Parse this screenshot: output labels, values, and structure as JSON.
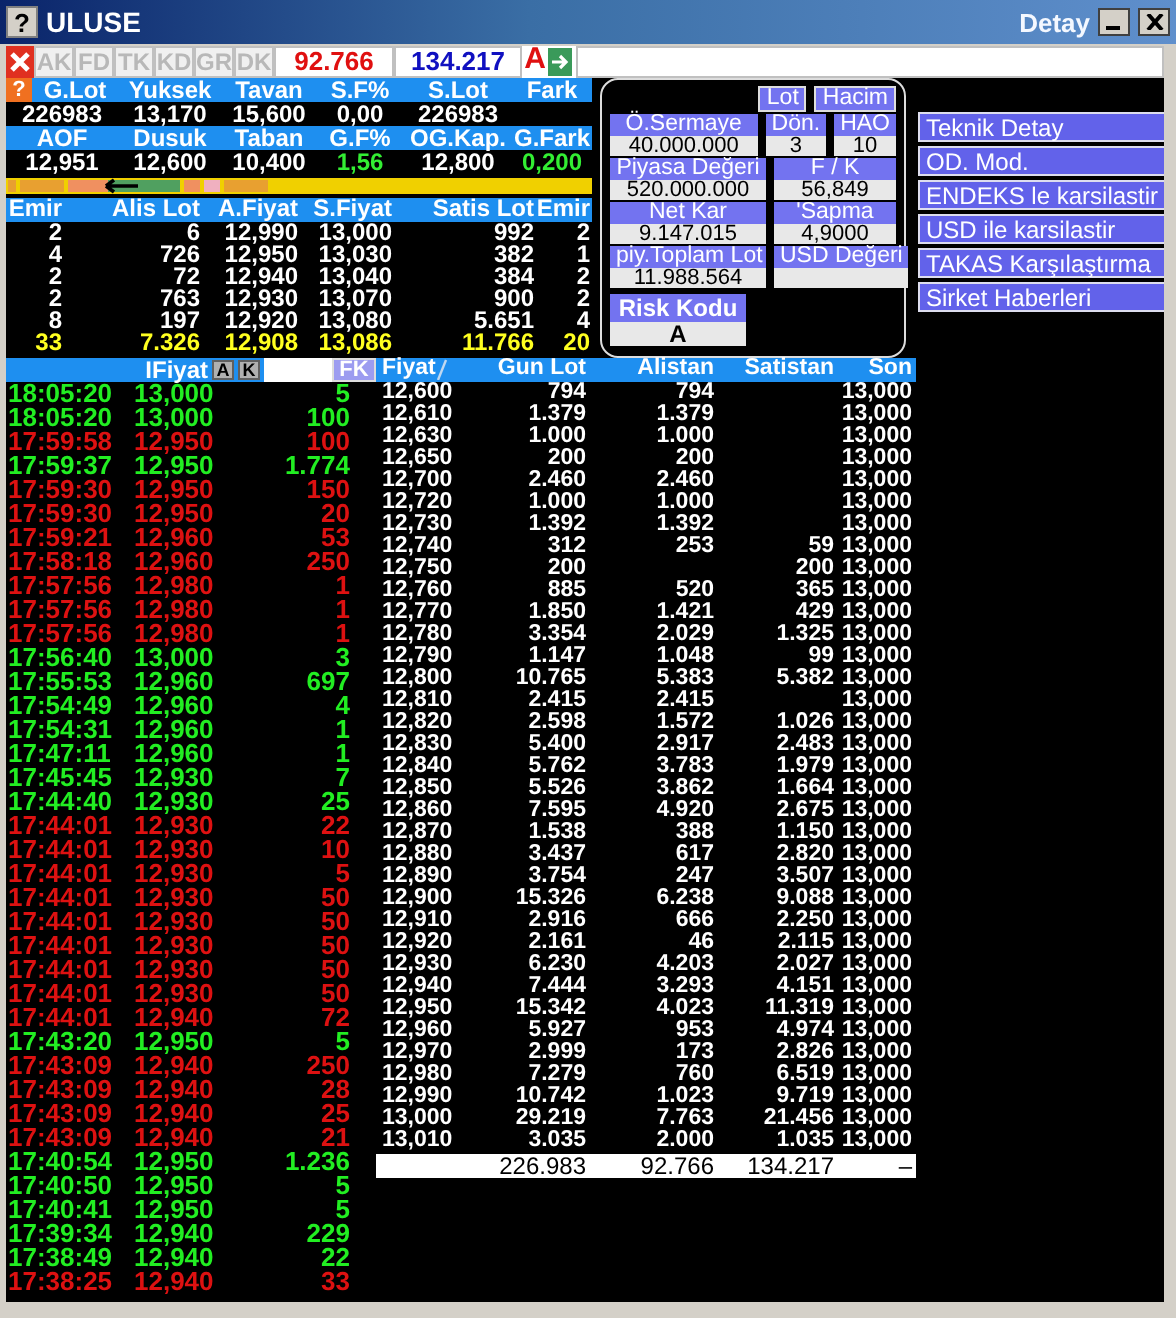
{
  "window": {
    "help": "?",
    "title": "ULUSE",
    "subtitle": "Detay"
  },
  "toolbar": {
    "tabs": [
      {
        "label": "AK",
        "disabled": true
      },
      {
        "label": "FD",
        "disabled": true
      },
      {
        "label": "TK",
        "disabled": true
      },
      {
        "label": "KD",
        "disabled": true
      },
      {
        "label": "GR",
        "disabled": true
      },
      {
        "label": "DK",
        "disabled": true
      }
    ],
    "buy_total": "92.766",
    "sell_total": "134.217",
    "alert": "A"
  },
  "quote": {
    "help": "?",
    "rows": [
      {
        "labels": [
          "G.Lot",
          "Yuksek",
          "Tavan",
          "S.F%",
          "S.Lot",
          "Fark"
        ],
        "values": [
          {
            "text": "226983",
            "kind": "plain"
          },
          {
            "text": "13,170",
            "kind": "plain"
          },
          {
            "text": "15,600",
            "kind": "plain"
          },
          {
            "text": "0,00",
            "kind": "plain"
          },
          {
            "text": "226983",
            "kind": "plain"
          }
        ]
      },
      {
        "labels": [
          "AOF",
          "Dusuk",
          "Taban",
          "G.F%",
          "OG.Kap.",
          "G.Fark"
        ],
        "values": [
          {
            "text": "12,951",
            "kind": "plain"
          },
          {
            "text": "12,600",
            "kind": "plain"
          },
          {
            "text": "10,400",
            "kind": "plain"
          },
          {
            "text": "1,56",
            "kind": "gain"
          },
          {
            "text": "12,800",
            "kind": "plain"
          },
          {
            "text": "0,200",
            "kind": "gain"
          }
        ]
      }
    ]
  },
  "depth": {
    "columns": [
      "Emir",
      "Alis Lot",
      "A.Fiyat",
      "S.Fiyat",
      "Satis Lot",
      "Emir"
    ],
    "rows": [
      [
        "2",
        "6",
        "12,990",
        "13,000",
        "992",
        "2"
      ],
      [
        "4",
        "726",
        "12,950",
        "13,030",
        "382",
        "1"
      ],
      [
        "2",
        "72",
        "12,940",
        "13,040",
        "384",
        "2"
      ],
      [
        "2",
        "763",
        "12,930",
        "13,070",
        "900",
        "2"
      ],
      [
        "8",
        "197",
        "12,920",
        "13,080",
        "5.651",
        "4"
      ]
    ],
    "totals": [
      "33",
      "7.326",
      "12,908",
      "13,086",
      "11.766",
      "20"
    ]
  },
  "panel": {
    "toggles": [
      "Lot",
      "Hacim"
    ],
    "stat_rows": [
      [
        {
          "label": "Ö.Sermaye",
          "value": "40.000.000"
        },
        {
          "label": "Dön.",
          "value": "3"
        },
        {
          "label": "HAO",
          "value": "10"
        }
      ],
      [
        {
          "label": "Piyasa Değeri",
          "value": "520.000.000"
        },
        {
          "label": "F / K",
          "value": "56,849"
        }
      ],
      [
        {
          "label": "Net Kar",
          "value": "9.147.015"
        },
        {
          "label": "'Sapma",
          "value": "4,9000"
        }
      ],
      [
        {
          "label": "piy.Toplam Lot",
          "value": "11.988.564"
        },
        {
          "label": "USD Değeri"
        }
      ]
    ],
    "risk": {
      "label": "Risk Kodu",
      "value": "A"
    }
  },
  "actions": [
    "Teknik Detay",
    "OD. Mod.",
    "ENDEKS le karsilastir",
    "USD ile karsilastir",
    "TAKAS Karşılaştırma",
    "Sirket Haberleri"
  ],
  "trades": {
    "header": "IFiyat",
    "buttons": [
      "A",
      "K"
    ],
    "filter": "FK",
    "rows": [
      {
        "time": "18:05:20",
        "price": "13,000",
        "lot": "5",
        "kind": "up"
      },
      {
        "time": "18:05:20",
        "price": "13,000",
        "lot": "100",
        "kind": "up"
      },
      {
        "time": "17:59:58",
        "price": "12,950",
        "lot": "100",
        "kind": "down"
      },
      {
        "time": "17:59:37",
        "price": "12,950",
        "lot": "1.774",
        "kind": "up"
      },
      {
        "time": "17:59:30",
        "price": "12,950",
        "lot": "150",
        "kind": "down"
      },
      {
        "time": "17:59:30",
        "price": "12,950",
        "lot": "20",
        "kind": "down"
      },
      {
        "time": "17:59:21",
        "price": "12,960",
        "lot": "53",
        "kind": "down"
      },
      {
        "time": "17:58:18",
        "price": "12,960",
        "lot": "250",
        "kind": "down"
      },
      {
        "time": "17:57:56",
        "price": "12,980",
        "lot": "1",
        "kind": "down"
      },
      {
        "time": "17:57:56",
        "price": "12,980",
        "lot": "1",
        "kind": "down"
      },
      {
        "time": "17:57:56",
        "price": "12,980",
        "lot": "1",
        "kind": "down"
      },
      {
        "time": "17:56:40",
        "price": "13,000",
        "lot": "3",
        "kind": "up"
      },
      {
        "time": "17:55:53",
        "price": "12,960",
        "lot": "697",
        "kind": "up"
      },
      {
        "time": "17:54:49",
        "price": "12,960",
        "lot": "4",
        "kind": "up"
      },
      {
        "time": "17:54:31",
        "price": "12,960",
        "lot": "1",
        "kind": "up"
      },
      {
        "time": "17:47:11",
        "price": "12,960",
        "lot": "1",
        "kind": "up"
      },
      {
        "time": "17:45:45",
        "price": "12,930",
        "lot": "7",
        "kind": "up"
      },
      {
        "time": "17:44:40",
        "price": "12,930",
        "lot": "25",
        "kind": "up"
      },
      {
        "time": "17:44:01",
        "price": "12,930",
        "lot": "22",
        "kind": "down"
      },
      {
        "time": "17:44:01",
        "price": "12,930",
        "lot": "10",
        "kind": "down"
      },
      {
        "time": "17:44:01",
        "price": "12,930",
        "lot": "5",
        "kind": "down"
      },
      {
        "time": "17:44:01",
        "price": "12,930",
        "lot": "50",
        "kind": "down"
      },
      {
        "time": "17:44:01",
        "price": "12,930",
        "lot": "50",
        "kind": "down"
      },
      {
        "time": "17:44:01",
        "price": "12,930",
        "lot": "50",
        "kind": "down"
      },
      {
        "time": "17:44:01",
        "price": "12,930",
        "lot": "50",
        "kind": "down"
      },
      {
        "time": "17:44:01",
        "price": "12,930",
        "lot": "50",
        "kind": "down"
      },
      {
        "time": "17:44:01",
        "price": "12,940",
        "lot": "72",
        "kind": "down"
      },
      {
        "time": "17:43:20",
        "price": "12,950",
        "lot": "5",
        "kind": "up"
      },
      {
        "time": "17:43:09",
        "price": "12,940",
        "lot": "250",
        "kind": "down"
      },
      {
        "time": "17:43:09",
        "price": "12,940",
        "lot": "28",
        "kind": "down"
      },
      {
        "time": "17:43:09",
        "price": "12,940",
        "lot": "25",
        "kind": "down"
      },
      {
        "time": "17:43:09",
        "price": "12,940",
        "lot": "21",
        "kind": "down"
      },
      {
        "time": "17:40:54",
        "price": "12,950",
        "lot": "1.236",
        "kind": "up"
      },
      {
        "time": "17:40:50",
        "price": "12,950",
        "lot": "5",
        "kind": "up"
      },
      {
        "time": "17:40:41",
        "price": "12,950",
        "lot": "5",
        "kind": "up"
      },
      {
        "time": "17:39:34",
        "price": "12,940",
        "lot": "229",
        "kind": "up"
      },
      {
        "time": "17:38:49",
        "price": "12,940",
        "lot": "22",
        "kind": "up"
      },
      {
        "time": "17:38:25",
        "price": "12,940",
        "lot": "33",
        "kind": "down"
      }
    ]
  },
  "price_table": {
    "columns": [
      "Fiyat",
      "Gun Lot",
      "Alistan",
      "Satistan",
      "Son"
    ],
    "rows": [
      {
        "fiyat": "12,600",
        "gun_lot": "794",
        "alistan": "794",
        "son": "13,000"
      },
      {
        "fiyat": "12,610",
        "gun_lot": "1.379",
        "alistan": "1.379",
        "son": "13,000"
      },
      {
        "fiyat": "12,630",
        "gun_lot": "1.000",
        "alistan": "1.000",
        "son": "13,000"
      },
      {
        "fiyat": "12,650",
        "gun_lot": "200",
        "alistan": "200",
        "son": "13,000"
      },
      {
        "fiyat": "12,700",
        "gun_lot": "2.460",
        "alistan": "2.460",
        "son": "13,000"
      },
      {
        "fiyat": "12,720",
        "gun_lot": "1.000",
        "alistan": "1.000",
        "son": "13,000"
      },
      {
        "fiyat": "12,730",
        "gun_lot": "1.392",
        "alistan": "1.392",
        "son": "13,000"
      },
      {
        "fiyat": "12,740",
        "gun_lot": "312",
        "alistan": "253",
        "satistan": "59",
        "son": "13,000"
      },
      {
        "fiyat": "12,750",
        "gun_lot": "200",
        "satistan": "200",
        "son": "13,000"
      },
      {
        "fiyat": "12,760",
        "gun_lot": "885",
        "alistan": "520",
        "satistan": "365",
        "son": "13,000"
      },
      {
        "fiyat": "12,770",
        "gun_lot": "1.850",
        "alistan": "1.421",
        "satistan": "429",
        "son": "13,000"
      },
      {
        "fiyat": "12,780",
        "gun_lot": "3.354",
        "alistan": "2.029",
        "satistan": "1.325",
        "son": "13,000"
      },
      {
        "fiyat": "12,790",
        "gun_lot": "1.147",
        "alistan": "1.048",
        "satistan": "99",
        "son": "13,000"
      },
      {
        "fiyat": "12,800",
        "gun_lot": "10.765",
        "alistan": "5.383",
        "satistan": "5.382",
        "son": "13,000"
      },
      {
        "fiyat": "12,810",
        "gun_lot": "2.415",
        "alistan": "2.415",
        "son": "13,000"
      },
      {
        "fiyat": "12,820",
        "gun_lot": "2.598",
        "alistan": "1.572",
        "satistan": "1.026",
        "son": "13,000"
      },
      {
        "fiyat": "12,830",
        "gun_lot": "5.400",
        "alistan": "2.917",
        "satistan": "2.483",
        "son": "13,000"
      },
      {
        "fiyat": "12,840",
        "gun_lot": "5.762",
        "alistan": "3.783",
        "satistan": "1.979",
        "son": "13,000"
      },
      {
        "fiyat": "12,850",
        "gun_lot": "5.526",
        "alistan": "3.862",
        "satistan": "1.664",
        "son": "13,000"
      },
      {
        "fiyat": "12,860",
        "gun_lot": "7.595",
        "alistan": "4.920",
        "satistan": "2.675",
        "son": "13,000"
      },
      {
        "fiyat": "12,870",
        "gun_lot": "1.538",
        "alistan": "388",
        "satistan": "1.150",
        "son": "13,000"
      },
      {
        "fiyat": "12,880",
        "gun_lot": "3.437",
        "alistan": "617",
        "satistan": "2.820",
        "son": "13,000"
      },
      {
        "fiyat": "12,890",
        "gun_lot": "3.754",
        "alistan": "247",
        "satistan": "3.507",
        "son": "13,000"
      },
      {
        "fiyat": "12,900",
        "gun_lot": "15.326",
        "alistan": "6.238",
        "satistan": "9.088",
        "son": "13,000"
      },
      {
        "fiyat": "12,910",
        "gun_lot": "2.916",
        "alistan": "666",
        "satistan": "2.250",
        "son": "13,000"
      },
      {
        "fiyat": "12,920",
        "gun_lot": "2.161",
        "alistan": "46",
        "satistan": "2.115",
        "son": "13,000"
      },
      {
        "fiyat": "12,930",
        "gun_lot": "6.230",
        "alistan": "4.203",
        "satistan": "2.027",
        "son": "13,000"
      },
      {
        "fiyat": "12,940",
        "gun_lot": "7.444",
        "alistan": "3.293",
        "satistan": "4.151",
        "son": "13,000"
      },
      {
        "fiyat": "12,950",
        "gun_lot": "15.342",
        "alistan": "4.023",
        "satistan": "11.319",
        "son": "13,000"
      },
      {
        "fiyat": "12,960",
        "gun_lot": "5.927",
        "alistan": "953",
        "satistan": "4.974",
        "son": "13,000"
      },
      {
        "fiyat": "12,970",
        "gun_lot": "2.999",
        "alistan": "173",
        "satistan": "2.826",
        "son": "13,000"
      },
      {
        "fiyat": "12,980",
        "gun_lot": "7.279",
        "alistan": "760",
        "satistan": "6.519",
        "son": "13,000"
      },
      {
        "fiyat": "12,990",
        "gun_lot": "10.742",
        "alistan": "1.023",
        "satistan": "9.719",
        "son": "13,000"
      },
      {
        "fiyat": "13,000",
        "gun_lot": "29.219",
        "alistan": "7.763",
        "satistan": "21.456",
        "son": "13,000"
      },
      {
        "fiyat": "13,010",
        "gun_lot": "3.035",
        "alistan": "2.000",
        "satistan": "1.035",
        "son": "13,000"
      }
    ],
    "totals": {
      "gun_lot": "226.983",
      "alistan": "92.766",
      "satistan": "134.217",
      "son": "–"
    }
  }
}
